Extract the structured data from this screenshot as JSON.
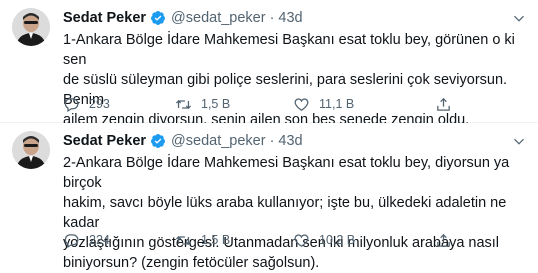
{
  "tweets": [
    {
      "author": {
        "name": "Sedat Peker",
        "handle": "@sedat_peker"
      },
      "time": "43d",
      "lines": [
        "1-Ankara Bölge İdare Mahkemesi Başkanı esat toklu bey, görünen o ki sen",
        "de süslü süleyman gibi poliçe seslerini, para seslerini çok seviyorsun. Benim",
        "ailem zengin diyorsun, senin ailen son beş senede zengin oldu."
      ],
      "stats": {
        "replies": "293",
        "retweets": "1,5 B",
        "likes": "11,1 B"
      }
    },
    {
      "author": {
        "name": "Sedat Peker",
        "handle": "@sedat_peker"
      },
      "time": "43d",
      "lines": [
        "2-Ankara Bölge İdare Mahkemesi Başkanı esat toklu bey, diyorsun ya birçok",
        "hakim, savcı böyle lüks araba kullanıyor; işte bu, ülkedeki adaletin ne kadar",
        "yozlaştığının göstergesi. Utanmadan sen iki milyonluk arabaya nasıl",
        "biniyorsun? (zengin fetöcüler sağolsun)."
      ],
      "stats": {
        "replies": "224",
        "retweets": "1,5 B",
        "likes": "10,2 B"
      }
    }
  ],
  "icons": {
    "verified": "verified-badge-icon",
    "more": "chevron-down-icon",
    "reply": "reply-icon",
    "retweet": "retweet-icon",
    "like": "heart-icon",
    "share": "share-icon"
  },
  "colors": {
    "text": "#0f1419",
    "secondary": "#536471",
    "verified": "#1d9bf0",
    "divider": "#eff3f4"
  }
}
